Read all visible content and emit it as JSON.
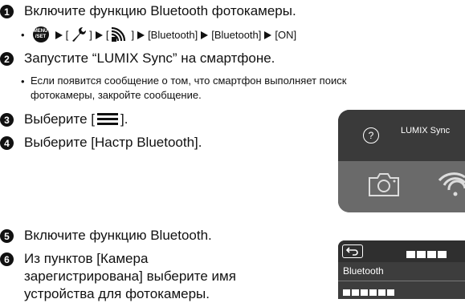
{
  "steps": [
    {
      "number": "1",
      "text": "Включите функцию Bluetooth фотокамеры."
    },
    {
      "number": "2",
      "text": "Запустите “LUMIX Sync” на смартфоне."
    },
    {
      "number": "3",
      "text_before": "Выберите [",
      "text_after": "]."
    },
    {
      "number": "4",
      "text": "Выберите [Настр Bluetooth]."
    },
    {
      "number": "5",
      "text": "Включите функцию Bluetooth."
    },
    {
      "number": "6",
      "lines": [
        "Из пунктов [Камера",
        "зарегистрирована] выберите имя",
        "устройства для фотокамеры."
      ]
    }
  ],
  "step1_path": {
    "bullet": "•",
    "menu_icon_top": "MENU",
    "menu_icon_bottom": "/SET",
    "bracket_open": "[",
    "bracket_close": "]",
    "items": [
      "[Bluetooth]",
      "[Bluetooth]",
      "[ON]"
    ]
  },
  "step2_note": {
    "bullet": "•",
    "lines": [
      "Если появится сообщение о том, что смартфон выполняет поиск",
      "фотокамеры, закройте сообщение."
    ]
  },
  "phone_screen_1": {
    "help_symbol": "?",
    "title": "LUMIX Sync"
  },
  "phone_screen_2": {
    "label": "Bluetooth"
  },
  "icons": [
    "menu-set-icon",
    "wrench-icon",
    "wireless-icon",
    "arrow-right-icon",
    "menu-hamburger-icon",
    "camera-icon",
    "wifi-icon",
    "back-icon",
    "help-icon"
  ]
}
